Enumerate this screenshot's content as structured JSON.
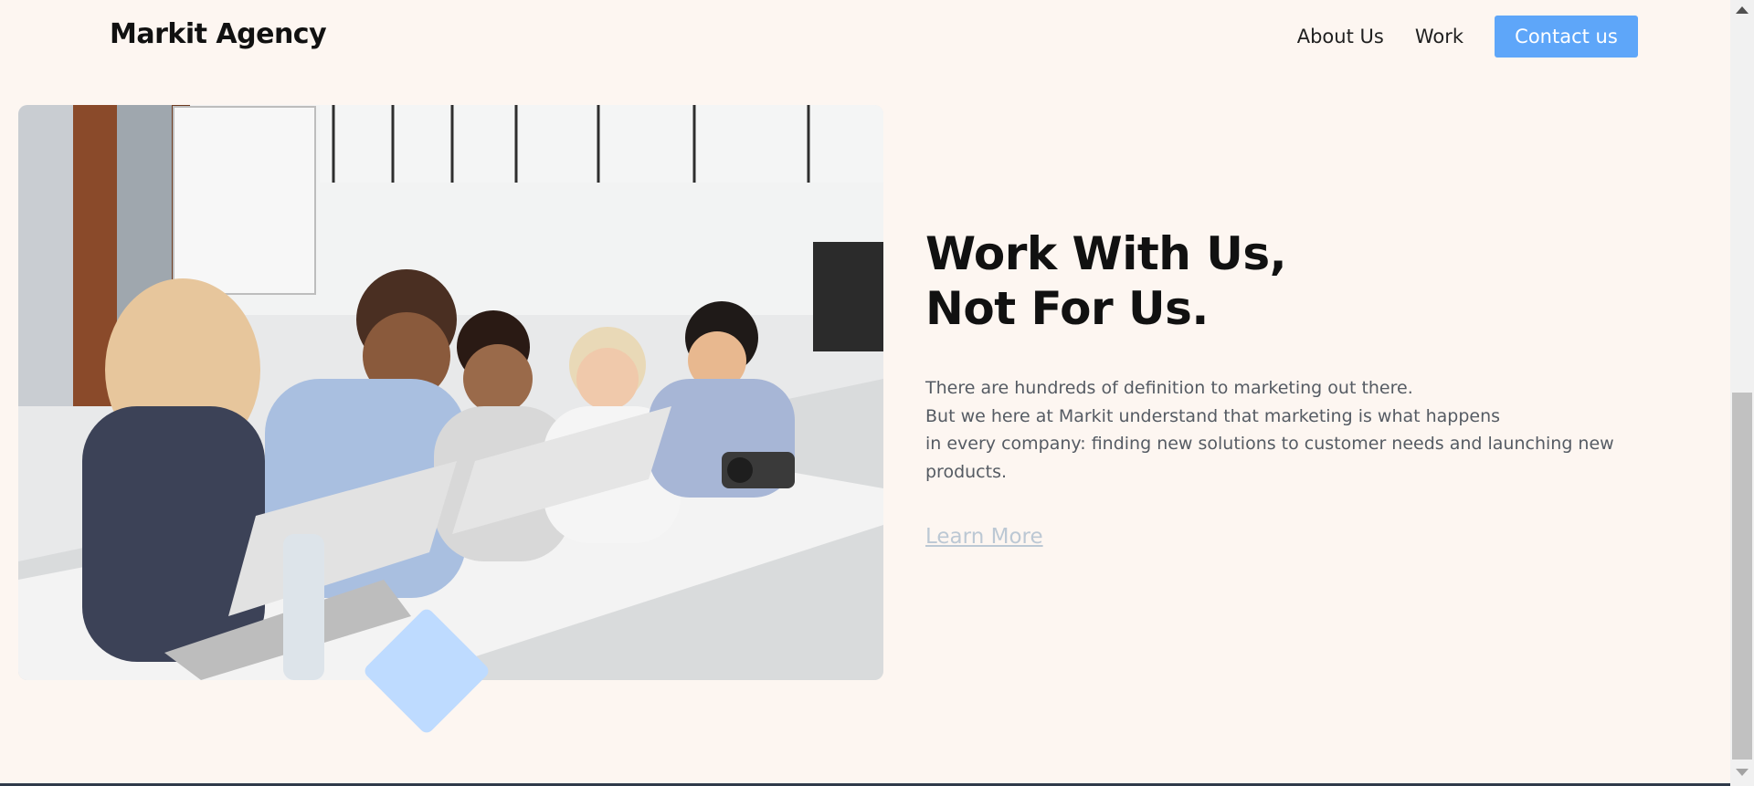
{
  "header": {
    "brand": "Markit Agency",
    "nav": {
      "about": "About Us",
      "work": "Work",
      "contact": "Contact us"
    }
  },
  "hero": {
    "image_label": "Team of colleagues working together at laptops in an office",
    "title_lines": [
      "Work With Us,",
      "Not For Us."
    ],
    "body_lines": [
      "There are hundreds of definition to marketing out there.",
      "But we here at Markit understand that marketing is what happens",
      "in every company: finding new solutions to customer needs and launching new",
      "products."
    ],
    "cta": "Learn More"
  },
  "colors": {
    "background": "#fdf6f1",
    "accent": "#5ea6f9",
    "diamond": "#bedbff",
    "cta_link": "#bcc8d4"
  },
  "icons": {
    "scroll_up": "triangle-up-icon",
    "scroll_down": "triangle-down-icon"
  }
}
